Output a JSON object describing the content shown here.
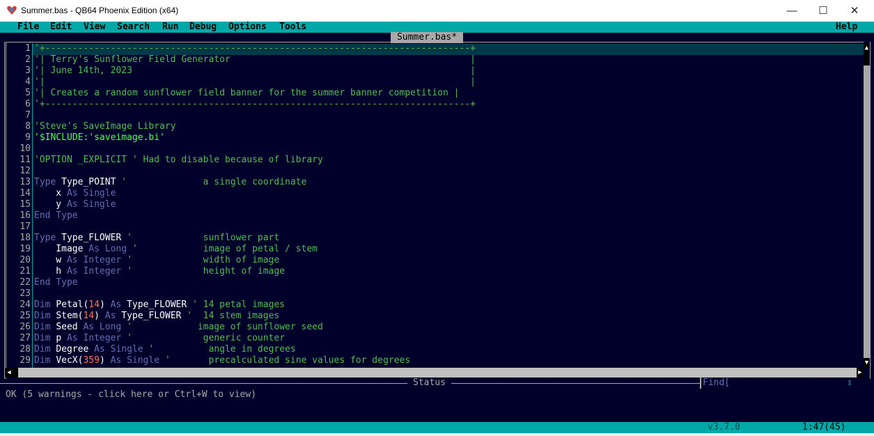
{
  "window": {
    "title": "Summer.bas - QB64 Phoenix Edition (x64)",
    "minimize_glyph": "—",
    "maximize_glyph": "☐",
    "close_glyph": "✕",
    "icon": "qb64-heart-icon"
  },
  "menu": [
    "File",
    "Edit",
    "View",
    "Search",
    "Run",
    "Debug",
    "Options",
    "Tools"
  ],
  "help_label": "Help",
  "editor": {
    "file_tab": "Summer.bas*",
    "line_numbers": [
      "1",
      "2",
      "3",
      "4",
      "5",
      "6",
      "7",
      "8",
      "9",
      "10",
      "11",
      "12",
      "13",
      "14",
      "15",
      "16",
      "17",
      "18",
      "19",
      "20",
      "21",
      "22",
      "23",
      "24",
      "25",
      "26",
      "27",
      "28",
      "29"
    ]
  },
  "code_lines": [
    [
      {
        "t": "'+------------------------------------------------------------------------------+",
        "c": "cm"
      }
    ],
    [
      {
        "t": "'| Terry's Sunflower Field Generator                                            |",
        "c": "cm"
      }
    ],
    [
      {
        "t": "'| June 14th, 2023                                                              |",
        "c": "cm"
      }
    ],
    [
      {
        "t": "'|                                                                              |",
        "c": "cm"
      }
    ],
    [
      {
        "t": "'| Creates a random sunflower field banner for the summer banner competition |",
        "c": "cm"
      }
    ],
    [
      {
        "t": "'+------------------------------------------------------------------------------+",
        "c": "cm"
      }
    ],
    [],
    [
      {
        "t": "'Steve's SaveImage Library",
        "c": "cm"
      }
    ],
    [
      {
        "t": "'$INCLUDE:'saveimage.bi'",
        "c": "cl"
      }
    ],
    [],
    [
      {
        "t": "'OPTION _EXPLICIT ' Had to disable because of library",
        "c": "cm"
      }
    ],
    [],
    [
      {
        "t": "Type ",
        "c": "kw"
      },
      {
        "t": "Type_POINT ",
        "c": "id"
      },
      {
        "t": "'              a single coordinate",
        "c": "cm"
      }
    ],
    [
      {
        "t": "    x ",
        "c": "id"
      },
      {
        "t": "As Single",
        "c": "kw"
      }
    ],
    [
      {
        "t": "    y ",
        "c": "id"
      },
      {
        "t": "As Single",
        "c": "kw"
      }
    ],
    [
      {
        "t": "End Type",
        "c": "kw"
      }
    ],
    [],
    [
      {
        "t": "Type ",
        "c": "kw"
      },
      {
        "t": "Type_FLOWER ",
        "c": "id"
      },
      {
        "t": "'             sunflower part",
        "c": "cm"
      }
    ],
    [
      {
        "t": "    Image ",
        "c": "id"
      },
      {
        "t": "As Long ",
        "c": "kw"
      },
      {
        "t": "'            image of petal / stem",
        "c": "cm"
      }
    ],
    [
      {
        "t": "    w ",
        "c": "id"
      },
      {
        "t": "As Integer ",
        "c": "kw"
      },
      {
        "t": "'             width of image",
        "c": "cm"
      }
    ],
    [
      {
        "t": "    h ",
        "c": "id"
      },
      {
        "t": "As Integer ",
        "c": "kw"
      },
      {
        "t": "'             height of image",
        "c": "cm"
      }
    ],
    [
      {
        "t": "End Type",
        "c": "kw"
      }
    ],
    [],
    [
      {
        "t": "Dim ",
        "c": "kw"
      },
      {
        "t": "Petal(",
        "c": "id"
      },
      {
        "t": "14",
        "c": "nm"
      },
      {
        "t": ") ",
        "c": "id"
      },
      {
        "t": "As ",
        "c": "kw"
      },
      {
        "t": "Type_FLOWER ",
        "c": "id"
      },
      {
        "t": "' 14 petal images",
        "c": "cm"
      }
    ],
    [
      {
        "t": "Dim ",
        "c": "kw"
      },
      {
        "t": "Stem(",
        "c": "id"
      },
      {
        "t": "14",
        "c": "nm"
      },
      {
        "t": ") ",
        "c": "id"
      },
      {
        "t": "As ",
        "c": "kw"
      },
      {
        "t": "Type_FLOWER ",
        "c": "id"
      },
      {
        "t": "'  14 stem images",
        "c": "cm"
      }
    ],
    [
      {
        "t": "Dim ",
        "c": "kw"
      },
      {
        "t": "Seed ",
        "c": "id"
      },
      {
        "t": "As Long ",
        "c": "kw"
      },
      {
        "t": "'            image of sunflower seed",
        "c": "cm"
      }
    ],
    [
      {
        "t": "Dim ",
        "c": "kw"
      },
      {
        "t": "p ",
        "c": "id"
      },
      {
        "t": "As Integer ",
        "c": "kw"
      },
      {
        "t": "'             generic counter",
        "c": "cm"
      }
    ],
    [
      {
        "t": "Dim ",
        "c": "kw"
      },
      {
        "t": "Degree ",
        "c": "id"
      },
      {
        "t": "As Single ",
        "c": "kw"
      },
      {
        "t": "'          angle in degrees",
        "c": "cm"
      }
    ],
    [
      {
        "t": "Dim ",
        "c": "kw"
      },
      {
        "t": "VecX(",
        "c": "id"
      },
      {
        "t": "359",
        "c": "nm"
      },
      {
        "t": ") ",
        "c": "id"
      },
      {
        "t": "As Single ",
        "c": "kw"
      },
      {
        "t": "'       precalculated sine values for degrees",
        "c": "cm"
      }
    ]
  ],
  "status": {
    "label": "Status",
    "message": "OK (5 warnings - click here or Ctrl+W to view)"
  },
  "find": {
    "label": "Find[",
    "arrows": "⇕"
  },
  "info": {
    "version": "v3.7.0",
    "cursor": "1:47(45)"
  },
  "colors": {
    "editor_bg": "#00002a",
    "menu_bg": "#00a8a8",
    "comment": "#55bb55",
    "keyword": "#5f6fb0",
    "identifier": "#ffffff",
    "number": "#ff7755"
  }
}
